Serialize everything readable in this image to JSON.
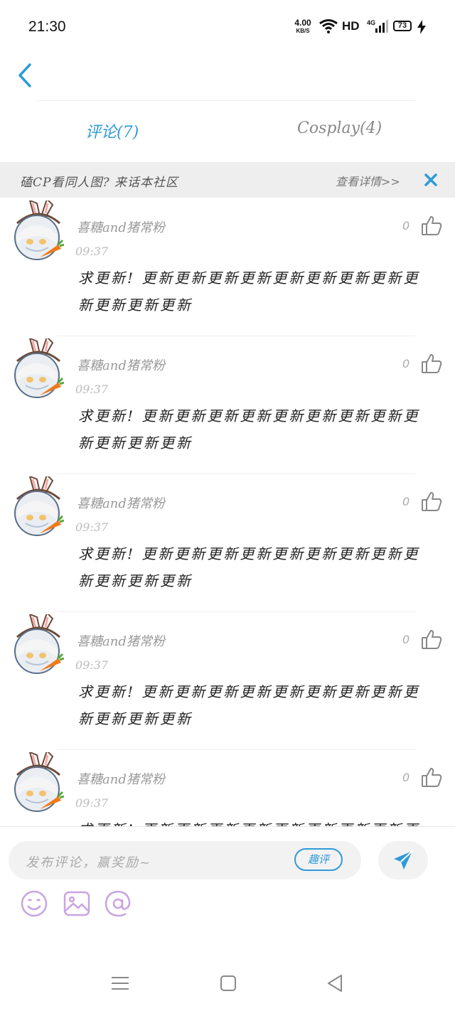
{
  "status_bar": {
    "time": "21:30",
    "speed_value": "4.00",
    "speed_unit": "KB/S",
    "hd": "HD",
    "network": "4G",
    "battery": "73"
  },
  "tabs": {
    "comments": "评论(7)",
    "cosplay": "Cosplay(4)"
  },
  "banner": {
    "text": "磕CP看同人图? 来话本社区",
    "link": "查看详情>>"
  },
  "comments": [
    {
      "user": "喜糖and猪常粉",
      "time": "09:37",
      "text": "求更新! 更新更新更新更新更新更新更新更新更新更新更新更新",
      "likes": "0"
    },
    {
      "user": "喜糖and猪常粉",
      "time": "09:37",
      "text": "求更新! 更新更新更新更新更新更新更新更新更新更新更新更新",
      "likes": "0"
    },
    {
      "user": "喜糖and猪常粉",
      "time": "09:37",
      "text": "求更新! 更新更新更新更新更新更新更新更新更新更新更新更新",
      "likes": "0"
    },
    {
      "user": "喜糖and猪常粉",
      "time": "09:37",
      "text": "求更新! 更新更新更新更新更新更新更新更新更新更新更新更新",
      "likes": "0"
    },
    {
      "user": "喜糖and猪常粉",
      "time": "09:37",
      "text": "求更新! 更新更新更新更新更新更新更新更新更新更新更新更新",
      "likes": "0"
    }
  ],
  "composer": {
    "placeholder": "发布评论，赢奖励~",
    "fun_comment": "趣评"
  },
  "colors": {
    "accent": "#2e9ad8",
    "tool_purple": "#c9a3e3"
  },
  "icons": [
    "back-icon",
    "close-icon",
    "thumbs-up-icon",
    "send-icon",
    "emoji-icon",
    "image-icon",
    "mention-icon",
    "menu-icon",
    "home-icon",
    "nav-back-icon"
  ]
}
